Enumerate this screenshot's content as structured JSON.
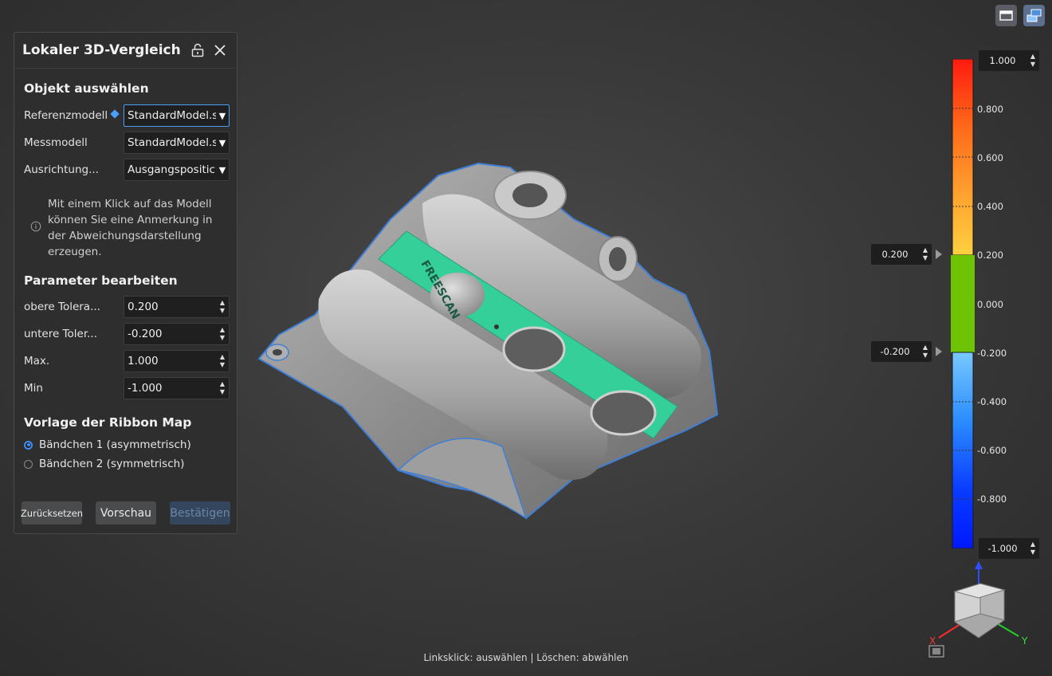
{
  "toolbar": {
    "buttons": [
      {
        "icon": "window-icon"
      },
      {
        "icon": "view-switch-icon"
      }
    ]
  },
  "panel": {
    "title": "Lokaler 3D-Vergleich",
    "section_select": "Objekt auswählen",
    "fields": {
      "reference": {
        "label": "Referenzmodell",
        "value": "StandardModel.s"
      },
      "measure": {
        "label": "Messmodell",
        "value": "StandardModel.s"
      },
      "alignment": {
        "label": "Ausrichtung...",
        "value": "Ausgangspositic"
      }
    },
    "info": "Mit einem Klick auf das Modell können Sie eine Anmerkung in der Abweichungsdarstellung erzeugen.",
    "section_params": "Parameter bearbeiten",
    "params": {
      "upper": {
        "label": "obere Tolera...",
        "value": "0.200"
      },
      "lower": {
        "label": "untere Toler...",
        "value": "-0.200"
      },
      "max": {
        "label": "Max.",
        "value": "1.000"
      },
      "min": {
        "label": "Min",
        "value": "-1.000"
      }
    },
    "section_ribbon": "Vorlage der Ribbon Map",
    "ribbon_options": {
      "opt1": {
        "label": "Bändchen 1 (asymmetrisch)",
        "selected": true
      },
      "opt2": {
        "label": "Bändchen 2 (symmetrisch)",
        "selected": false
      }
    },
    "buttons": {
      "reset": "Zurücksetzen",
      "preview": "Vorschau",
      "confirm": "Bestätigen"
    }
  },
  "model": {
    "engraving": "FREESCAN"
  },
  "colorbar": {
    "max_value": "1.000",
    "min_value": "-1.000",
    "upper_tol": "0.200",
    "lower_tol": "-0.200",
    "labels": {
      "l080": "0.800",
      "l060": "0.600",
      "l040": "0.400",
      "l020": "0.200",
      "l000": "0.000",
      "lm020": "-0.200",
      "lm040": "-0.400",
      "lm060": "-0.600",
      "lm080": "-0.800"
    },
    "tolerance_color": "#6ec404"
  },
  "viewcube": {
    "axis_x": "X",
    "axis_y": "Y"
  },
  "status": "Linksklick: auswählen | Löschen: abwählen"
}
